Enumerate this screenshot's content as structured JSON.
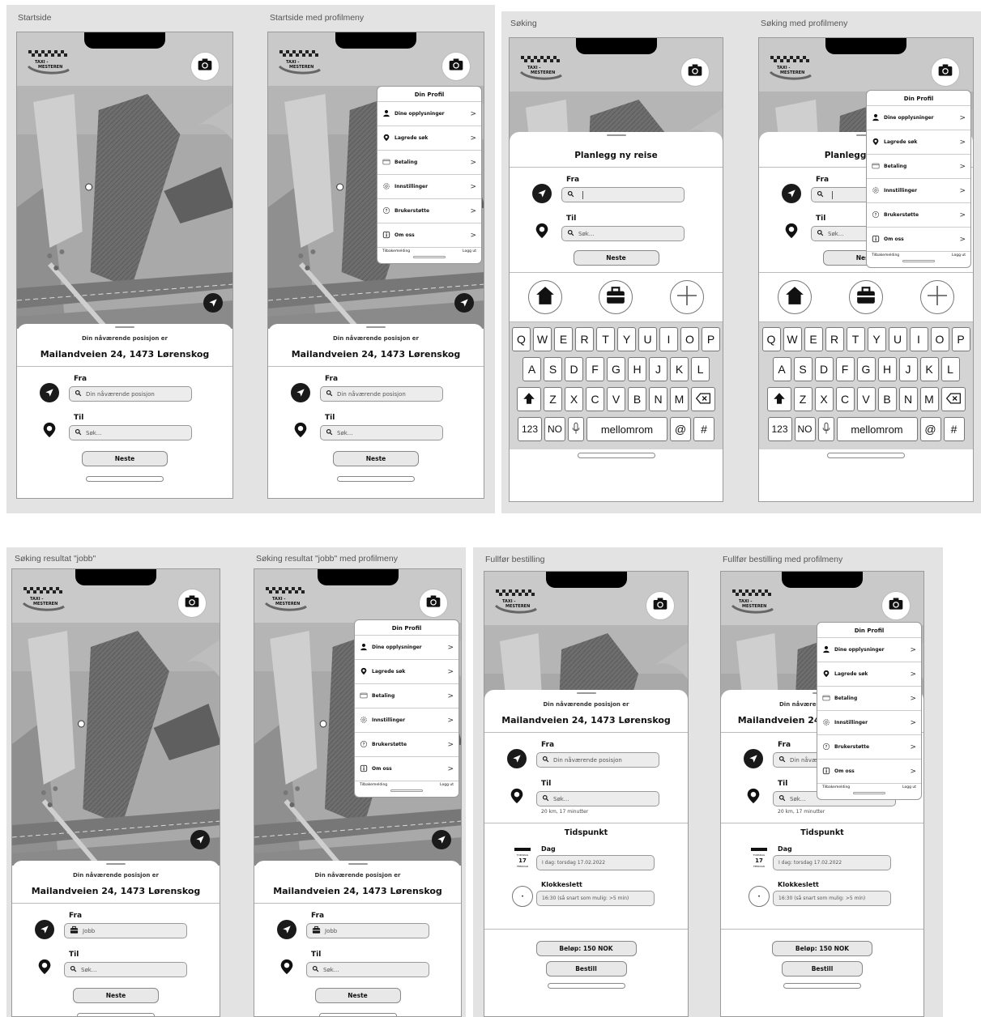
{
  "frames": {
    "startside": "Startside",
    "startside_menu": "Startside med profilmeny",
    "soking": "Søking",
    "soking_menu": "Søking med profilmeny",
    "result": "Søking resultat \"jobb\"",
    "result_menu": "Søking resultat \"jobb\" med profilmeny",
    "fullfor": "Fullfør bestilling",
    "fullfor_menu": "Fullfør bestilling med profilmeny"
  },
  "logo": {
    "line1": "TAXI -",
    "line2": "MESTEREN"
  },
  "position": {
    "caption": "Din nåværende posisjon er",
    "address": "Mailandveien 24, 1473 Lørenskog"
  },
  "form": {
    "fra_label": "Fra",
    "til_label": "Til",
    "fra_placeholder": "Din nåværende posisjon",
    "til_placeholder": "Søk...",
    "next": "Neste",
    "jobb": "Jobb",
    "distance": "20 km, 17 minutter"
  },
  "plan_title": "Planlegg ny reise",
  "keyboard": {
    "row1": [
      "Q",
      "W",
      "E",
      "R",
      "T",
      "Y",
      "U",
      "I",
      "O",
      "P"
    ],
    "row2": [
      "A",
      "S",
      "D",
      "F",
      "G",
      "H",
      "J",
      "K",
      "L"
    ],
    "row3": [
      "Z",
      "X",
      "C",
      "V",
      "B",
      "N",
      "M"
    ],
    "num": "123",
    "lang": "NO",
    "space": "mellomrom",
    "at": "@",
    "hash": "#"
  },
  "menu": {
    "title": "Din Profil",
    "items": [
      "Dine opplysninger",
      "Lagrede søk",
      "Betaling",
      "Innstillinger",
      "Brukerstøtte",
      "Om oss"
    ],
    "feedback": "Tilbakemelding",
    "logout": "Logg ut"
  },
  "time": {
    "title": "Tidspunkt",
    "day_label": "Dag",
    "day_value": "I dag: torsdag 17.02.2022",
    "clock_label": "Klokkeslett",
    "clock_value": "16:30 (så snart som mulig: >5 min)",
    "cal_day": "TORSDAG",
    "cal_num": "17",
    "cal_month": "FEBRUAR"
  },
  "order": {
    "amount": "Beløp: 150 NOK",
    "submit": "Bestill"
  }
}
